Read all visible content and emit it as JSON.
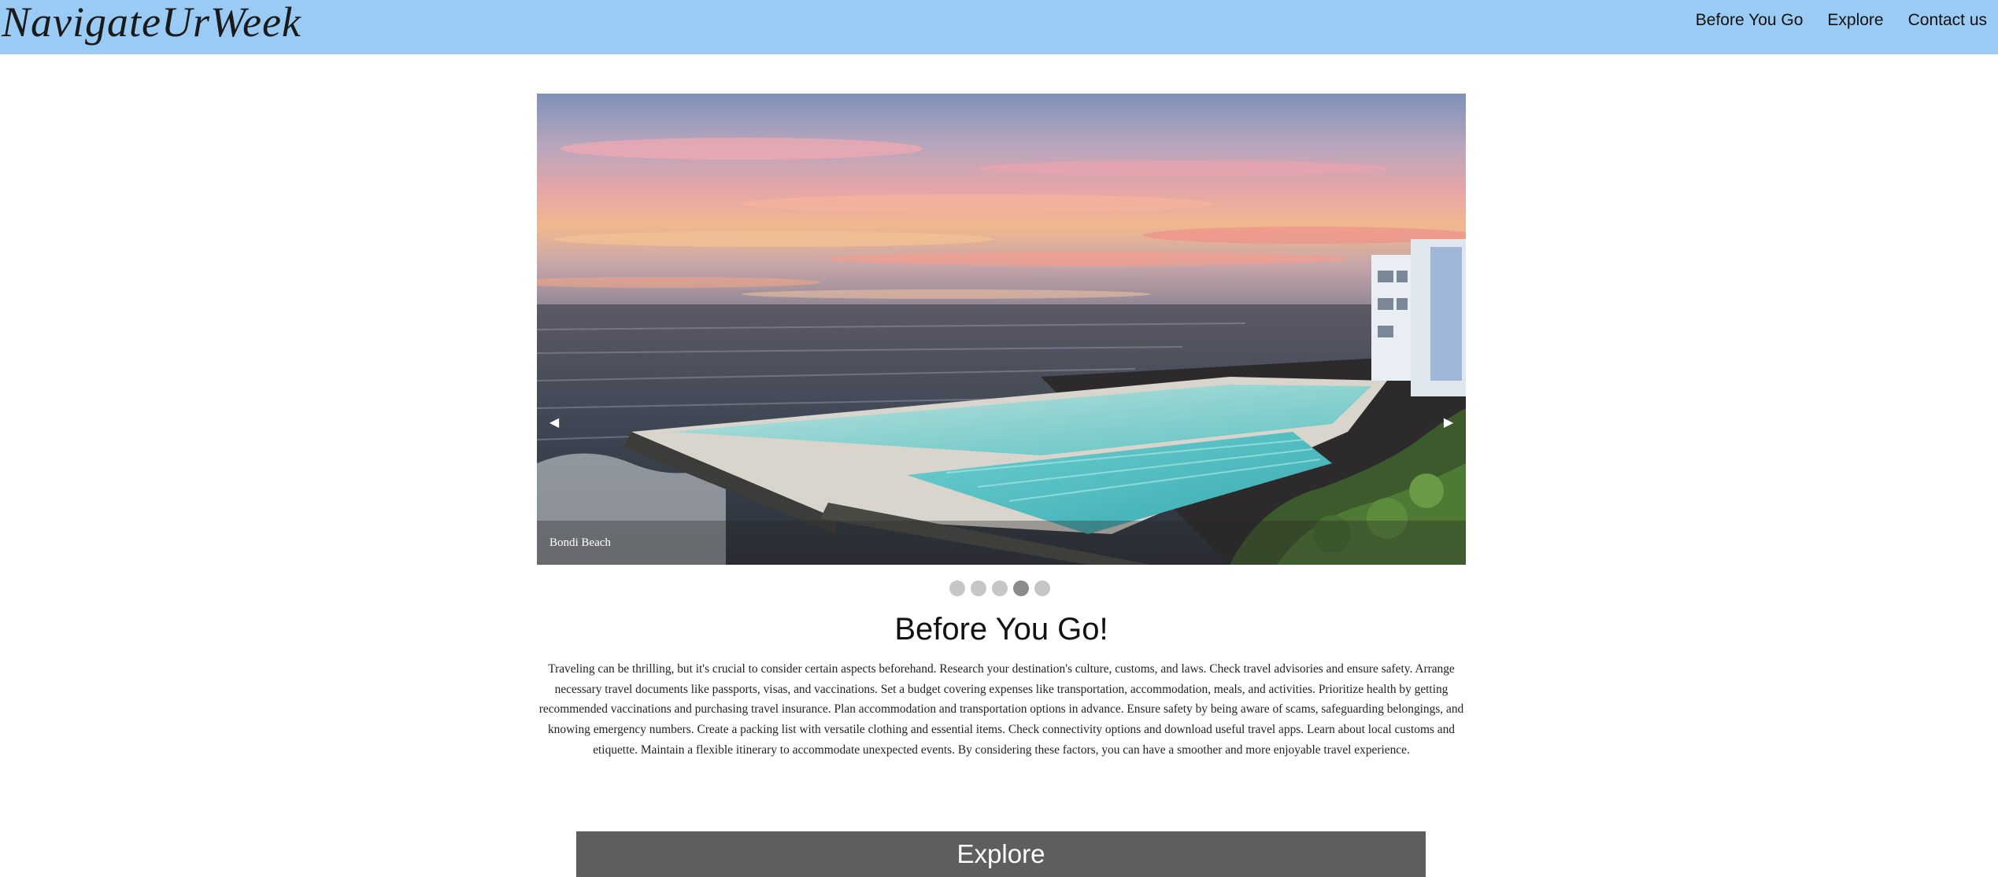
{
  "header": {
    "logo": "NavigateUrWeek",
    "nav": [
      "Before You Go",
      "Explore",
      "Contact us"
    ],
    "background_color": "#99cbf4"
  },
  "slider": {
    "caption": "Bondi Beach",
    "prev_icon": "left-triangle-icon",
    "next_icon": "right-triangle-icon",
    "slide_count": 5,
    "active_slide": 4
  },
  "main": {
    "heading": "Before You Go!",
    "paragraph": "Traveling can be thrilling, but it's crucial to consider certain aspects beforehand. Research your destination's culture, customs, and laws. Check travel advisories and ensure safety. Arrange necessary travel documents like passports, visas, and vaccinations. Set a budget covering expenses like transportation, accommodation, meals, and activities. Prioritize health by getting recommended vaccinations and purchasing travel insurance. Plan accommodation and transportation options in advance. Ensure safety by being aware of scams, safeguarding belongings, and knowing emergency numbers. Create a packing list with versatile clothing and essential items. Check connectivity options and download useful travel apps. Learn about local customs and etiquette. Maintain a flexible itinerary to accommodate unexpected events. By considering these factors, you can have a smoother and more enjoyable travel experience."
  },
  "explore_section": {
    "label": "Explore",
    "background_color": "#5e5e5e"
  }
}
